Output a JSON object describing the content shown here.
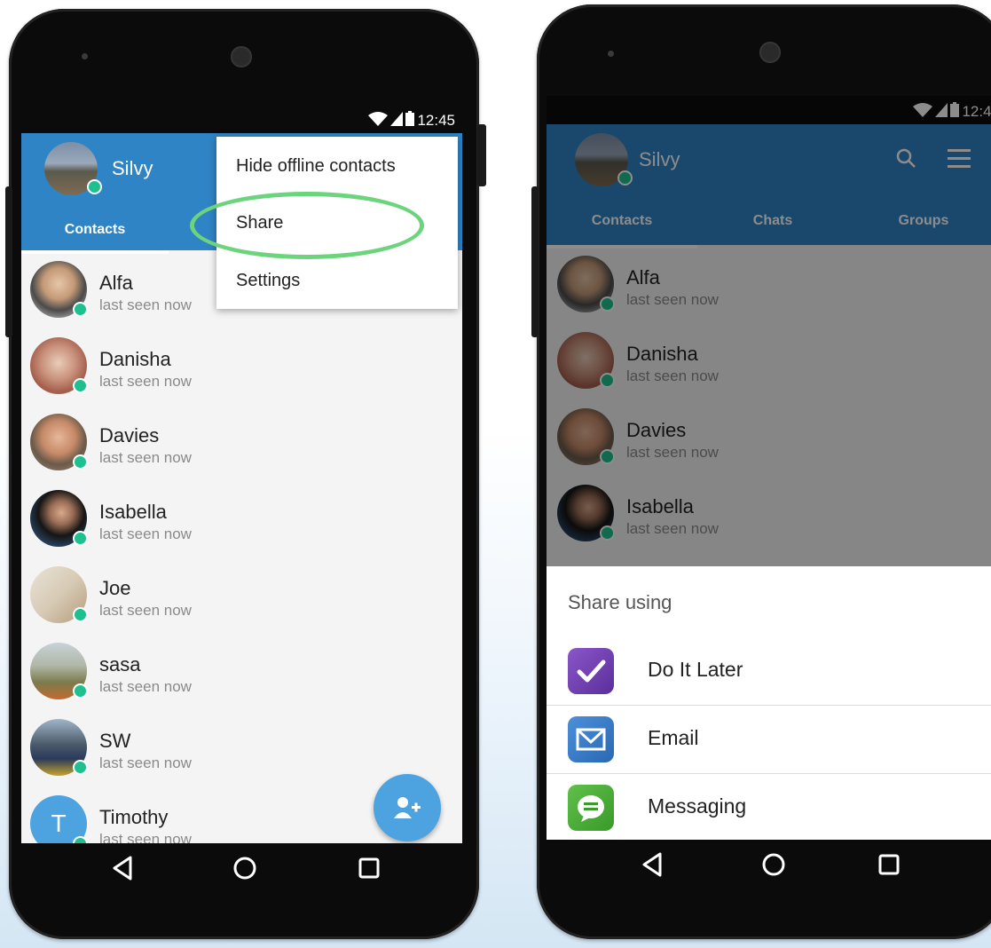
{
  "status": {
    "time": "12:45"
  },
  "left_screen": {
    "user_name": "Silvy",
    "tab_contacts": "Contacts",
    "menu": {
      "items": [
        "Hide offline contacts",
        "Share",
        "Settings"
      ]
    },
    "contacts": [
      {
        "name": "Alfa",
        "status": "last seen now"
      },
      {
        "name": "Danisha",
        "status": "last seen now"
      },
      {
        "name": "Davies",
        "status": "last seen now"
      },
      {
        "name": "Isabella",
        "status": "last seen now"
      },
      {
        "name": "Joe",
        "status": "last seen now"
      },
      {
        "name": "sasa",
        "status": "last seen now"
      },
      {
        "name": "SW",
        "status": "last seen now"
      },
      {
        "name": "Timothy",
        "status": "last seen now",
        "initial": "T"
      }
    ],
    "fab_icon": "add-contact-icon"
  },
  "right_screen": {
    "user_name": "Silvy",
    "tabs": [
      "Contacts",
      "Chats",
      "Groups"
    ],
    "contacts": [
      {
        "name": "Alfa",
        "status": "last seen now"
      },
      {
        "name": "Danisha",
        "status": "last seen now"
      },
      {
        "name": "Davies",
        "status": "last seen now"
      },
      {
        "name": "Isabella",
        "status": "last seen now"
      }
    ],
    "share_sheet": {
      "title": "Share using",
      "apps": [
        "Do It Later",
        "Email",
        "Messaging"
      ]
    }
  },
  "colors": {
    "appbar_blue": "#2f84c5",
    "appbar_dim": "#173e5c",
    "online_green": "#1fbf8f",
    "highlight_ellipse": "#6cd47c",
    "fab_blue": "#4da3e0"
  }
}
